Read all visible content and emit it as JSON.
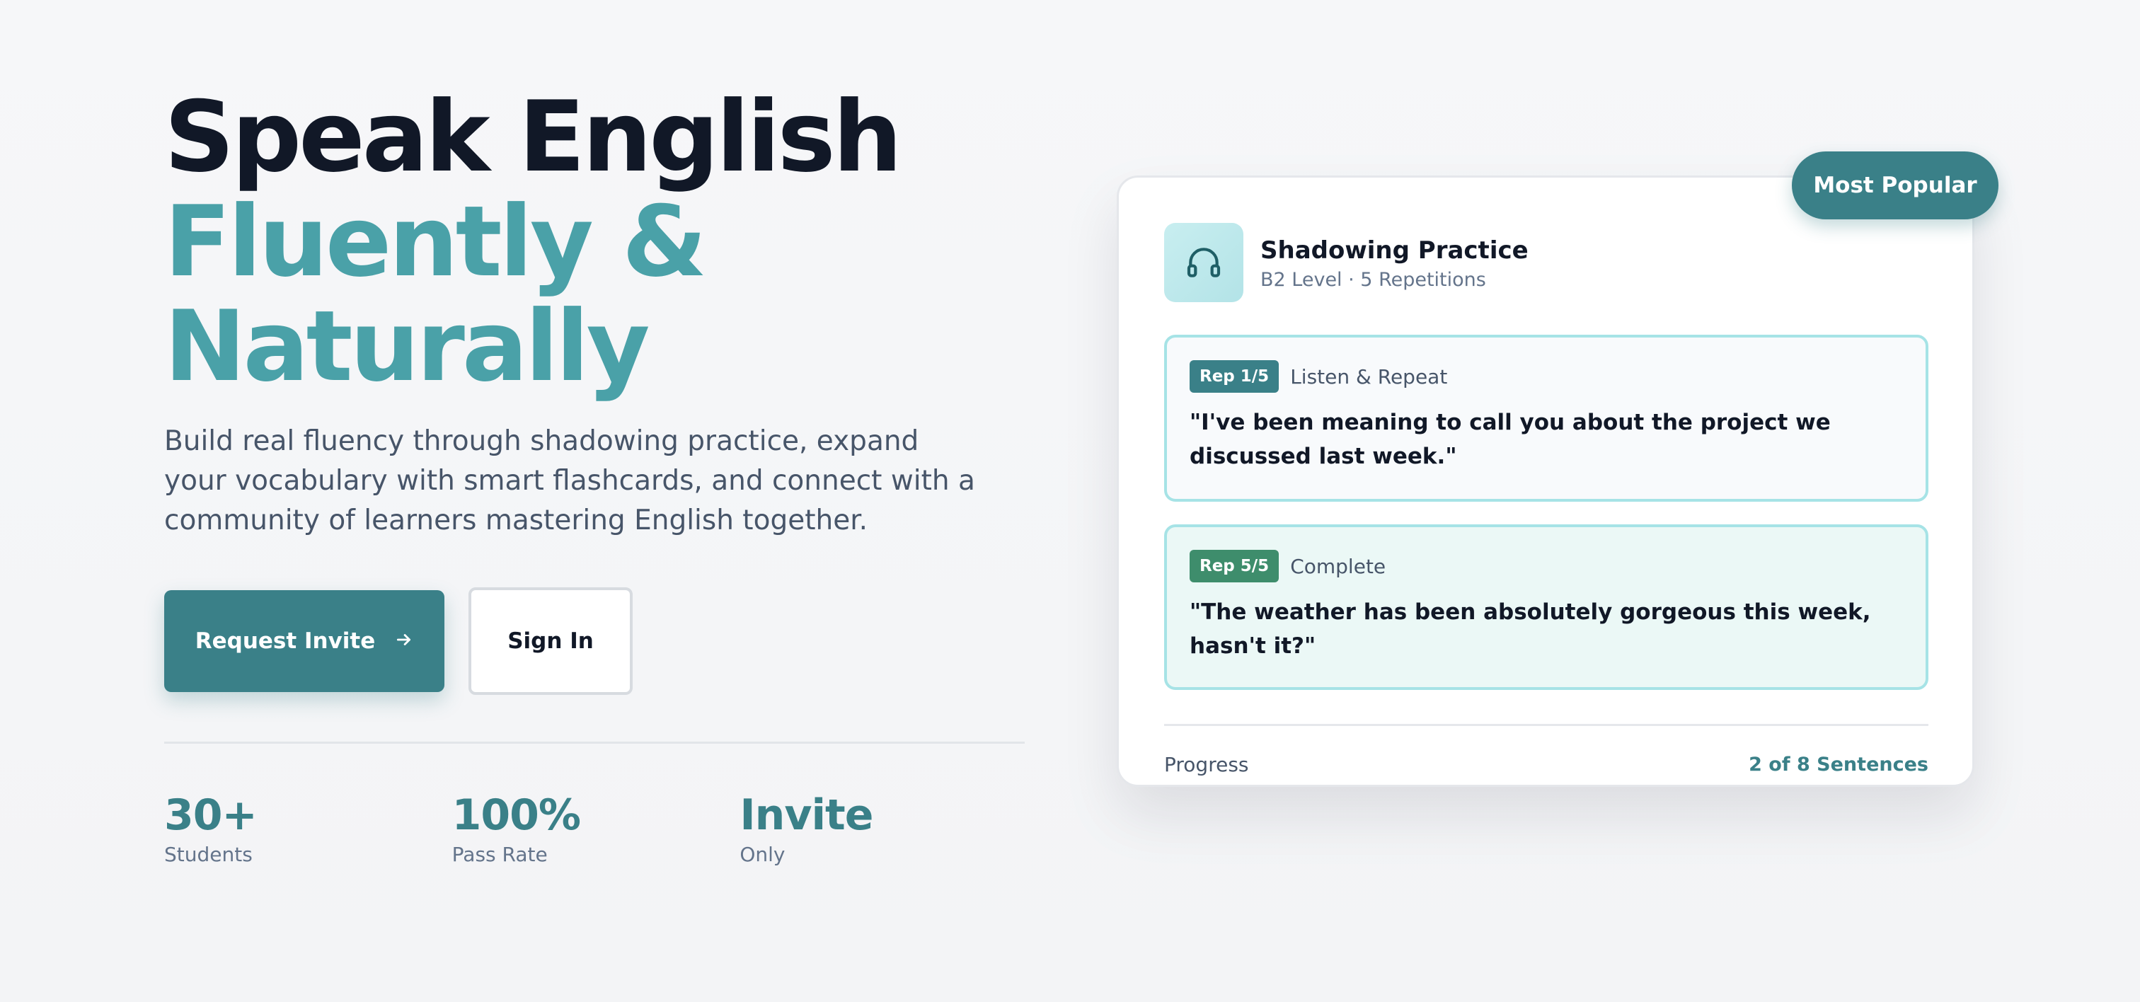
{
  "hero": {
    "headline_line1": "Speak English",
    "headline_line2": "Fluently &",
    "headline_line3": "Naturally",
    "subtitle": "Build real fluency through shadowing practice, expand your vocabulary with smart flashcards, and connect with a community of learners mastering English together.",
    "primary_button": "Request Invite",
    "primary_button_icon": "arrow-right-icon",
    "secondary_button": "Sign In"
  },
  "stats": [
    {
      "value": "30+",
      "label": "Students"
    },
    {
      "value": "100%",
      "label": "Pass Rate"
    },
    {
      "value": "Invite",
      "label": "Only"
    }
  ],
  "card": {
    "badge": "Most Popular",
    "icon": "headphones-icon",
    "title": "Shadowing Practice",
    "meta": "B2 Level · 5 Repetitions",
    "reps": [
      {
        "pill": "Rep 1/5",
        "status": "Listen & Repeat",
        "quote": "\"I've been meaning to call you about the project we discussed last week.\""
      },
      {
        "pill": "Rep 5/5",
        "status": "Complete",
        "quote": "\"The weather has been absolutely gorgeous this week, hasn't it?\""
      }
    ],
    "progress_label": "Progress",
    "progress_value": "2 of 8 Sentences"
  },
  "colors": {
    "accent": "#3a8088",
    "headline_teal": "#4aa1a8",
    "headline_dark": "#111827",
    "rep_border": "#a6e3e6",
    "complete_pill": "#3e8d6c"
  }
}
